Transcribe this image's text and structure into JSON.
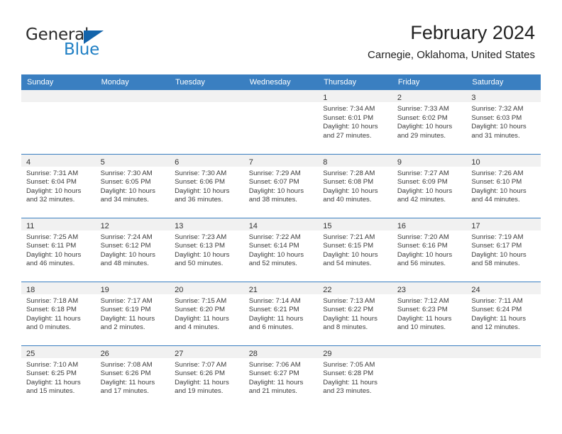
{
  "brand": {
    "name_top": "General",
    "name_bottom": "Blue",
    "color_blue": "#1f7fc4",
    "color_triangle": "#1364ab",
    "triangle_icon": "triangle-icon"
  },
  "header": {
    "title": "February 2024",
    "subtitle": "Carnegie, Oklahoma, United States"
  },
  "theme": {
    "header_row_bg": "#3a7fc1",
    "daynum_strip_bg": "#f1f1f1",
    "text": "#3b3b3b"
  },
  "weekday_headers": [
    "Sunday",
    "Monday",
    "Tuesday",
    "Wednesday",
    "Thursday",
    "Friday",
    "Saturday"
  ],
  "weeks": [
    [
      {
        "empty": true
      },
      {
        "empty": true
      },
      {
        "empty": true
      },
      {
        "empty": true
      },
      {
        "day": "1",
        "sunrise": "Sunrise: 7:34 AM",
        "sunset": "Sunset: 6:01 PM",
        "daylight1": "Daylight: 10 hours",
        "daylight2": "and 27 minutes."
      },
      {
        "day": "2",
        "sunrise": "Sunrise: 7:33 AM",
        "sunset": "Sunset: 6:02 PM",
        "daylight1": "Daylight: 10 hours",
        "daylight2": "and 29 minutes."
      },
      {
        "day": "3",
        "sunrise": "Sunrise: 7:32 AM",
        "sunset": "Sunset: 6:03 PM",
        "daylight1": "Daylight: 10 hours",
        "daylight2": "and 31 minutes."
      }
    ],
    [
      {
        "day": "4",
        "sunrise": "Sunrise: 7:31 AM",
        "sunset": "Sunset: 6:04 PM",
        "daylight1": "Daylight: 10 hours",
        "daylight2": "and 32 minutes."
      },
      {
        "day": "5",
        "sunrise": "Sunrise: 7:30 AM",
        "sunset": "Sunset: 6:05 PM",
        "daylight1": "Daylight: 10 hours",
        "daylight2": "and 34 minutes."
      },
      {
        "day": "6",
        "sunrise": "Sunrise: 7:30 AM",
        "sunset": "Sunset: 6:06 PM",
        "daylight1": "Daylight: 10 hours",
        "daylight2": "and 36 minutes."
      },
      {
        "day": "7",
        "sunrise": "Sunrise: 7:29 AM",
        "sunset": "Sunset: 6:07 PM",
        "daylight1": "Daylight: 10 hours",
        "daylight2": "and 38 minutes."
      },
      {
        "day": "8",
        "sunrise": "Sunrise: 7:28 AM",
        "sunset": "Sunset: 6:08 PM",
        "daylight1": "Daylight: 10 hours",
        "daylight2": "and 40 minutes."
      },
      {
        "day": "9",
        "sunrise": "Sunrise: 7:27 AM",
        "sunset": "Sunset: 6:09 PM",
        "daylight1": "Daylight: 10 hours",
        "daylight2": "and 42 minutes."
      },
      {
        "day": "10",
        "sunrise": "Sunrise: 7:26 AM",
        "sunset": "Sunset: 6:10 PM",
        "daylight1": "Daylight: 10 hours",
        "daylight2": "and 44 minutes."
      }
    ],
    [
      {
        "day": "11",
        "sunrise": "Sunrise: 7:25 AM",
        "sunset": "Sunset: 6:11 PM",
        "daylight1": "Daylight: 10 hours",
        "daylight2": "and 46 minutes."
      },
      {
        "day": "12",
        "sunrise": "Sunrise: 7:24 AM",
        "sunset": "Sunset: 6:12 PM",
        "daylight1": "Daylight: 10 hours",
        "daylight2": "and 48 minutes."
      },
      {
        "day": "13",
        "sunrise": "Sunrise: 7:23 AM",
        "sunset": "Sunset: 6:13 PM",
        "daylight1": "Daylight: 10 hours",
        "daylight2": "and 50 minutes."
      },
      {
        "day": "14",
        "sunrise": "Sunrise: 7:22 AM",
        "sunset": "Sunset: 6:14 PM",
        "daylight1": "Daylight: 10 hours",
        "daylight2": "and 52 minutes."
      },
      {
        "day": "15",
        "sunrise": "Sunrise: 7:21 AM",
        "sunset": "Sunset: 6:15 PM",
        "daylight1": "Daylight: 10 hours",
        "daylight2": "and 54 minutes."
      },
      {
        "day": "16",
        "sunrise": "Sunrise: 7:20 AM",
        "sunset": "Sunset: 6:16 PM",
        "daylight1": "Daylight: 10 hours",
        "daylight2": "and 56 minutes."
      },
      {
        "day": "17",
        "sunrise": "Sunrise: 7:19 AM",
        "sunset": "Sunset: 6:17 PM",
        "daylight1": "Daylight: 10 hours",
        "daylight2": "and 58 minutes."
      }
    ],
    [
      {
        "day": "18",
        "sunrise": "Sunrise: 7:18 AM",
        "sunset": "Sunset: 6:18 PM",
        "daylight1": "Daylight: 11 hours",
        "daylight2": "and 0 minutes."
      },
      {
        "day": "19",
        "sunrise": "Sunrise: 7:17 AM",
        "sunset": "Sunset: 6:19 PM",
        "daylight1": "Daylight: 11 hours",
        "daylight2": "and 2 minutes."
      },
      {
        "day": "20",
        "sunrise": "Sunrise: 7:15 AM",
        "sunset": "Sunset: 6:20 PM",
        "daylight1": "Daylight: 11 hours",
        "daylight2": "and 4 minutes."
      },
      {
        "day": "21",
        "sunrise": "Sunrise: 7:14 AM",
        "sunset": "Sunset: 6:21 PM",
        "daylight1": "Daylight: 11 hours",
        "daylight2": "and 6 minutes."
      },
      {
        "day": "22",
        "sunrise": "Sunrise: 7:13 AM",
        "sunset": "Sunset: 6:22 PM",
        "daylight1": "Daylight: 11 hours",
        "daylight2": "and 8 minutes."
      },
      {
        "day": "23",
        "sunrise": "Sunrise: 7:12 AM",
        "sunset": "Sunset: 6:23 PM",
        "daylight1": "Daylight: 11 hours",
        "daylight2": "and 10 minutes."
      },
      {
        "day": "24",
        "sunrise": "Sunrise: 7:11 AM",
        "sunset": "Sunset: 6:24 PM",
        "daylight1": "Daylight: 11 hours",
        "daylight2": "and 12 minutes."
      }
    ],
    [
      {
        "day": "25",
        "sunrise": "Sunrise: 7:10 AM",
        "sunset": "Sunset: 6:25 PM",
        "daylight1": "Daylight: 11 hours",
        "daylight2": "and 15 minutes."
      },
      {
        "day": "26",
        "sunrise": "Sunrise: 7:08 AM",
        "sunset": "Sunset: 6:26 PM",
        "daylight1": "Daylight: 11 hours",
        "daylight2": "and 17 minutes."
      },
      {
        "day": "27",
        "sunrise": "Sunrise: 7:07 AM",
        "sunset": "Sunset: 6:26 PM",
        "daylight1": "Daylight: 11 hours",
        "daylight2": "and 19 minutes."
      },
      {
        "day": "28",
        "sunrise": "Sunrise: 7:06 AM",
        "sunset": "Sunset: 6:27 PM",
        "daylight1": "Daylight: 11 hours",
        "daylight2": "and 21 minutes."
      },
      {
        "day": "29",
        "sunrise": "Sunrise: 7:05 AM",
        "sunset": "Sunset: 6:28 PM",
        "daylight1": "Daylight: 11 hours",
        "daylight2": "and 23 minutes."
      },
      {
        "empty": true
      },
      {
        "empty": true
      }
    ]
  ]
}
